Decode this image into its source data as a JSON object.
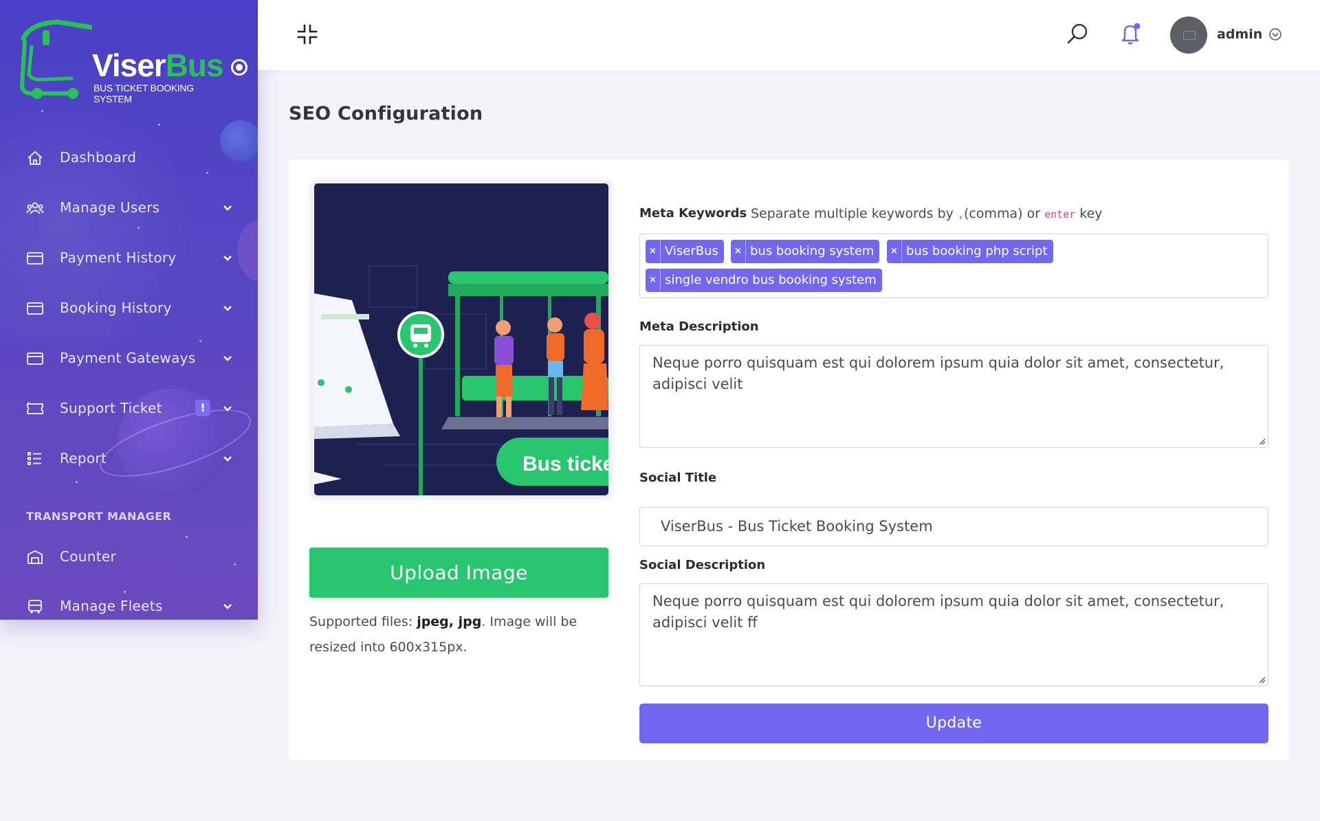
{
  "brand": {
    "name_part1": "Viser",
    "name_part2": "Bus",
    "tagline": "BUS TICKET BOOKING SYSTEM"
  },
  "sidebar": {
    "items": [
      {
        "label": "Dashboard",
        "icon": "home-icon",
        "has_submenu": false
      },
      {
        "label": "Manage Users",
        "icon": "users-icon",
        "has_submenu": true
      },
      {
        "label": "Payment History",
        "icon": "credit-card-icon",
        "has_submenu": true
      },
      {
        "label": "Booking History",
        "icon": "credit-card-icon",
        "has_submenu": true
      },
      {
        "label": "Payment Gateways",
        "icon": "credit-card-icon",
        "has_submenu": true
      },
      {
        "label": "Support Ticket",
        "icon": "ticket-icon",
        "has_submenu": true,
        "badge": "!"
      },
      {
        "label": "Report",
        "icon": "list-icon",
        "has_submenu": true
      }
    ],
    "section_title": "TRANSPORT MANAGER",
    "section_items": [
      {
        "label": "Counter",
        "icon": "building-icon",
        "has_submenu": false
      },
      {
        "label": "Manage Fleets",
        "icon": "bus-icon",
        "has_submenu": true
      }
    ]
  },
  "topbar": {
    "user_name": "admin",
    "icons": [
      "collapse-icon",
      "search-icon",
      "bell-icon",
      "avatar",
      "chevron-down-icon"
    ]
  },
  "page": {
    "title": "SEO Configuration"
  },
  "seo_image": {
    "preview_caption": "Bus ticket",
    "upload_label": "Upload Image",
    "note_prefix": "Supported files: ",
    "note_types": "jpeg, jpg",
    "note_suffix": ". Image will be resized into 600x315px."
  },
  "form": {
    "meta_keywords": {
      "label": "Meta Keywords",
      "hint_part1": "Separate multiple keywords by ",
      "hint_code1": ",",
      "hint_part2": "(comma) or ",
      "hint_code2": "enter",
      "hint_part3": " key",
      "tags": [
        "ViserBus",
        "bus booking system",
        "bus booking php script",
        "single vendro bus booking system"
      ]
    },
    "meta_description": {
      "label": "Meta Description",
      "value": "Neque porro quisquam est qui dolorem ipsum quia dolor sit amet, consectetur, adipisci velit"
    },
    "social_title": {
      "label": "Social Title",
      "value": "ViserBus - Bus Ticket Booking System"
    },
    "social_description": {
      "label": "Social Description",
      "value": "Neque porro quisquam est qui dolorem ipsum quia dolor sit amet, consectetur, adipisci velit ff"
    },
    "submit_label": "Update"
  },
  "colors": {
    "sidebar_gradient_top": "#4a3fc6",
    "sidebar_gradient_bottom": "#6a4bbd",
    "primary": "#7367f0",
    "success": "#28c66f",
    "brand_green": "#27c157",
    "page_bg": "#f3f3f9"
  }
}
